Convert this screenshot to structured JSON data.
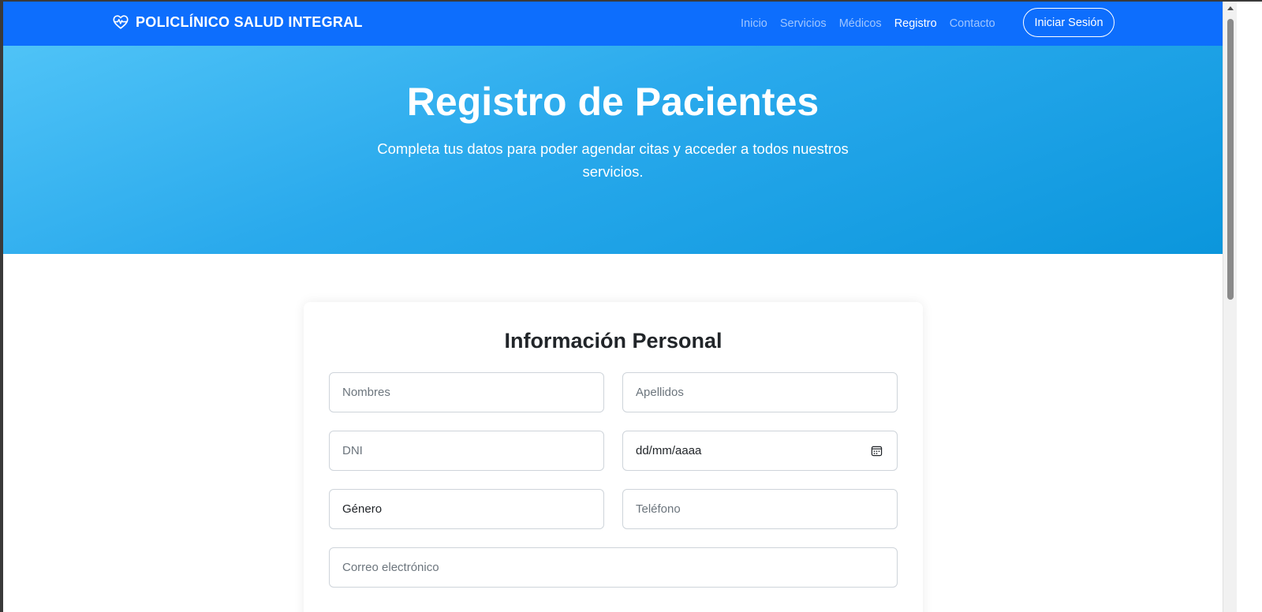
{
  "navbar": {
    "brand": "POLICLÍNICO SALUD INTEGRAL",
    "brand_icon": "heart-pulse-icon",
    "links": [
      {
        "label": "Inicio",
        "active": false
      },
      {
        "label": "Servicios",
        "active": false
      },
      {
        "label": "Médicos",
        "active": false
      },
      {
        "label": "Registro",
        "active": true
      },
      {
        "label": "Contacto",
        "active": false
      }
    ],
    "login_label": "Iniciar Sesión",
    "color": "#0d6efd"
  },
  "hero": {
    "title": "Registro de Pacientes",
    "subtitle": "Completa tus datos para poder agendar citas y acceder a todos nuestros servicios."
  },
  "form": {
    "title": "Información Personal",
    "fields": {
      "nombres": {
        "placeholder": "Nombres",
        "value": ""
      },
      "apellidos": {
        "placeholder": "Apellidos",
        "value": ""
      },
      "dni": {
        "placeholder": "DNI",
        "value": ""
      },
      "fecha": {
        "display": "dd/mm/aaaa",
        "icon": "calendar-icon"
      },
      "genero": {
        "selected": "Género"
      },
      "telefono": {
        "placeholder": "Teléfono",
        "value": ""
      },
      "correo": {
        "placeholder": "Correo electrónico",
        "value": ""
      }
    }
  }
}
